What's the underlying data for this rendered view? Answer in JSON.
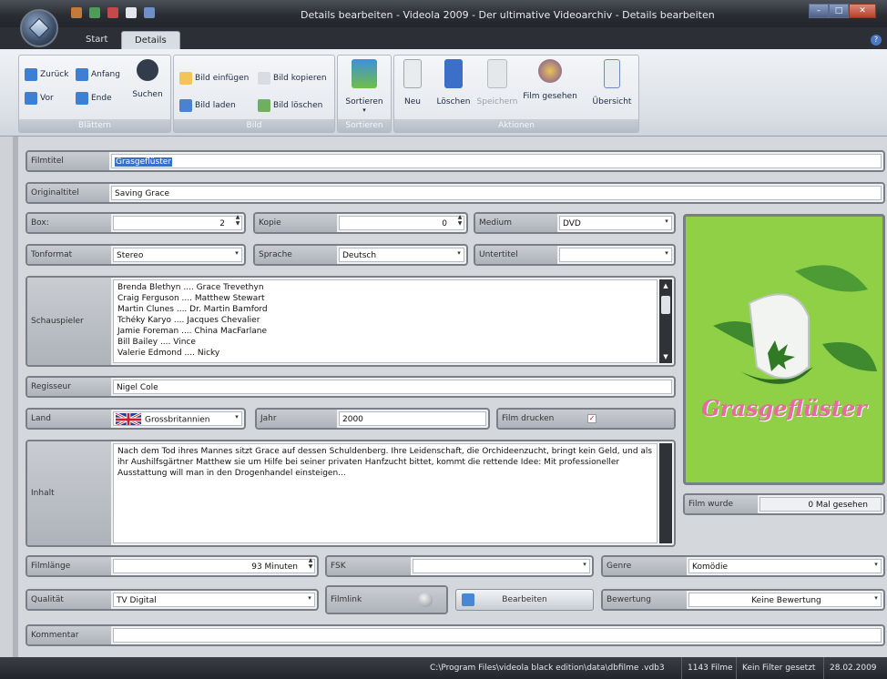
{
  "window": {
    "title": "Details bearbeiten - Videola 2009 - Der ultimative Videoarchiv - Details bearbeiten",
    "controls": [
      "minimize",
      "maximize",
      "close"
    ]
  },
  "tabs": [
    {
      "label": "Start",
      "active": false
    },
    {
      "label": "Details",
      "active": true
    }
  ],
  "ribbon": {
    "groups": {
      "blaettern": {
        "label": "Blättern",
        "zurueck": "Zurück",
        "anfang": "Anfang",
        "vor": "Vor",
        "ende": "Ende",
        "suchen": "Suchen"
      },
      "bild": {
        "label": "Bild",
        "einfuegen": "Bild einfügen",
        "kopieren": "Bild kopieren",
        "laden": "Bild laden",
        "loeschen": "Bild löschen"
      },
      "sortieren": {
        "label": "Sortieren",
        "button": "Sortieren"
      },
      "aktionen": {
        "label": "Aktionen",
        "neu": "Neu",
        "loeschen": "Löschen",
        "speichern": "Speichern",
        "film_gesehen": "Film gesehen",
        "uebersicht": "Übersicht"
      }
    }
  },
  "form": {
    "filmtitel": {
      "label": "Filmtitel",
      "value": "Grasgeflüster"
    },
    "originaltitel": {
      "label": "Originaltitel",
      "value": "Saving Grace"
    },
    "box": {
      "label": "Box:",
      "value": "2"
    },
    "kopie": {
      "label": "Kopie",
      "value": "0"
    },
    "medium": {
      "label": "Medium",
      "value": "DVD"
    },
    "tonformat": {
      "label": "Tonformat",
      "value": "Stereo"
    },
    "sprache": {
      "label": "Sprache",
      "value": "Deutsch"
    },
    "untertitel": {
      "label": "Untertitel",
      "value": ""
    },
    "schauspieler": {
      "label": "Schauspieler",
      "lines": [
        "Brenda Blethyn .... Grace Trevethyn",
        "Craig Ferguson .... Matthew Stewart",
        "Martin Clunes .... Dr. Martin Bamford",
        "Tchéky Karyo .... Jacques Chevalier",
        "Jamie Foreman .... China MacFarlane",
        "Bill Bailey .... Vince",
        "Valerie Edmond .... Nicky"
      ]
    },
    "regisseur": {
      "label": "Regisseur",
      "value": "Nigel Cole"
    },
    "land": {
      "label": "Land",
      "value": "Grossbritannien"
    },
    "jahr": {
      "label": "Jahr",
      "value": "2000"
    },
    "film_drucken": {
      "label": "Film drucken",
      "checked": true
    },
    "inhalt": {
      "label": "Inhalt",
      "value": "Nach dem Tod ihres Mannes sitzt Grace auf dessen Schuldenberg. Ihre Leidenschaft, die Orchideenzucht, bringt kein Geld, und als ihr Aushilfsgärtner Matthew sie um Hilfe bei seiner privaten Hanfzucht bittet, kommt die rettende Idee: Mit professioneller Ausstattung will man in den Drogenhandel einsteigen..."
    },
    "film_wurde": {
      "label": "Film wurde",
      "value": "0 Mal gesehen"
    },
    "filmlaenge": {
      "label": "Filmlänge",
      "value": "93 Minuten"
    },
    "fsk": {
      "label": "FSK",
      "value": ""
    },
    "genre": {
      "label": "Genre",
      "value": "Komödie"
    },
    "qualitaet": {
      "label": "Qualität",
      "value": "TV Digital"
    },
    "filmlink": {
      "label": "Filmlink"
    },
    "bearbeiten": {
      "label": "Bearbeiten"
    },
    "bewertung": {
      "label": "Bewertung",
      "value": "Keine Bewertung"
    },
    "kommentar": {
      "label": "Kommentar",
      "value": ""
    }
  },
  "poster": {
    "title_text": "Grasgeflüster",
    "bg_color": "#92d34a"
  },
  "statusbar": {
    "path": "C:\\Program Files\\videola black edition\\data\\dbfilme .vdb3",
    "count": "1143 Filme",
    "filter": "Kein Filter gesetzt",
    "date": "28.02.2009"
  }
}
